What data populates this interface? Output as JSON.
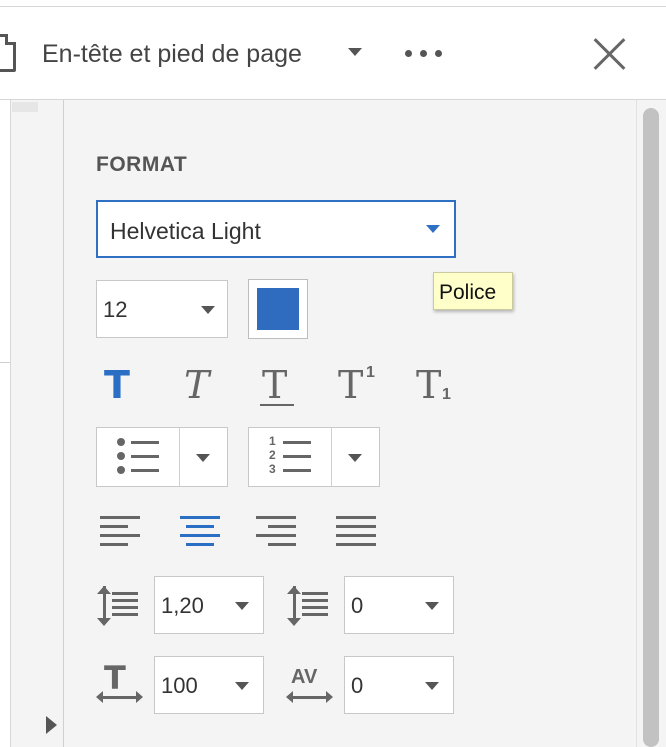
{
  "header": {
    "title": "En-tête et pied de page"
  },
  "panel": {
    "section_label": "FORMAT",
    "font_select": {
      "value": "Helvetica Light"
    },
    "tooltip": "Police",
    "font_size": "12",
    "text_color": "#2f6cbf",
    "line_spacing": "1,20",
    "paragraph_spacing": "0",
    "horizontal_scale": "100",
    "character_spacing": "0",
    "char_spacing_label": "AV",
    "ordered_list_digits": [
      "1",
      "2",
      "3"
    ],
    "superscript_digit": "1",
    "subscript_digit": "1"
  },
  "icons": {
    "text_styles": [
      "bold-text-icon",
      "italic-text-icon",
      "underline-text-icon",
      "superscript-icon",
      "subscript-icon"
    ],
    "alignment": [
      "align-left-icon",
      "align-center-icon",
      "align-right-icon",
      "justify-icon"
    ]
  },
  "colors": {
    "accent": "#2f6fc4",
    "tooltip_bg": "#ffffca"
  }
}
